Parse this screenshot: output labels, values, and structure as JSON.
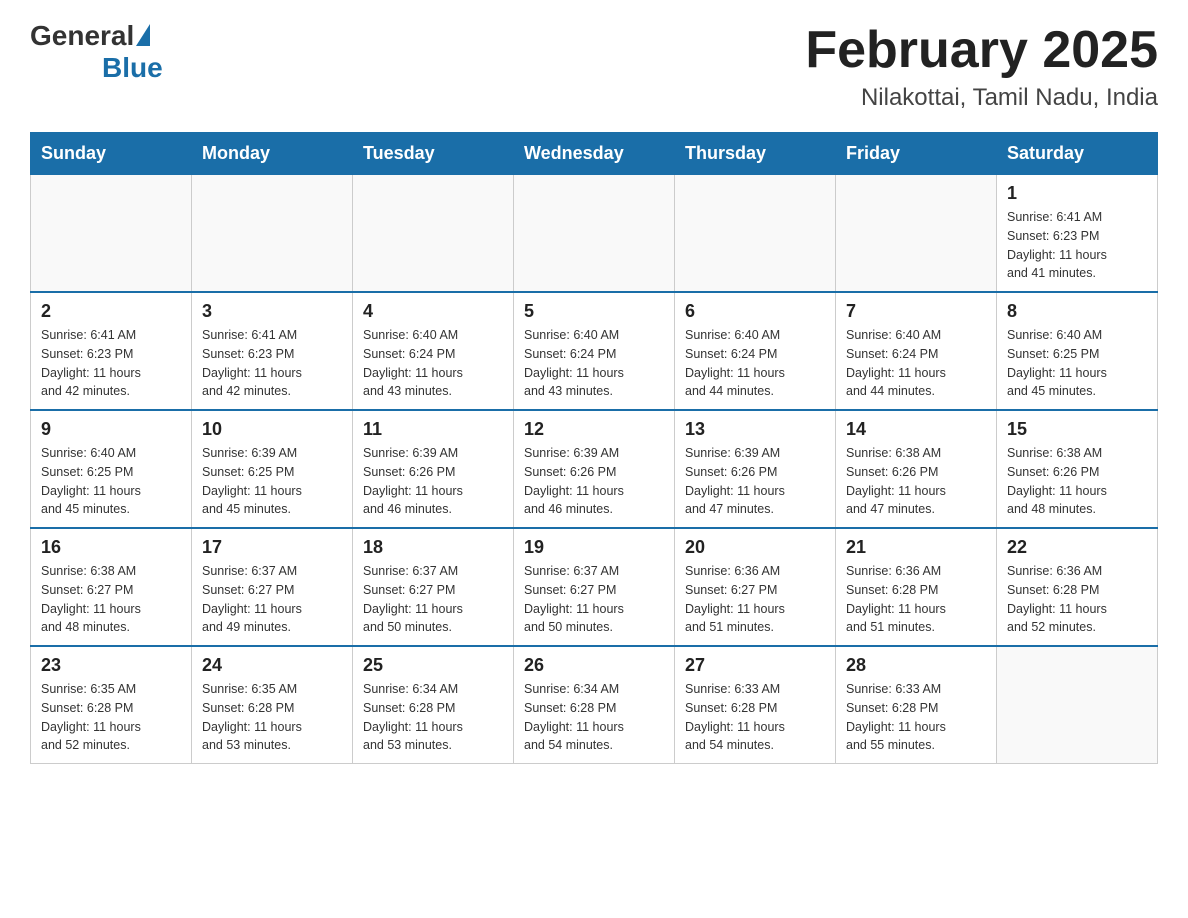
{
  "header": {
    "logo_general": "General",
    "logo_blue": "Blue",
    "month_title": "February 2025",
    "location": "Nilakottai, Tamil Nadu, India"
  },
  "weekdays": [
    "Sunday",
    "Monday",
    "Tuesday",
    "Wednesday",
    "Thursday",
    "Friday",
    "Saturday"
  ],
  "weeks": [
    [
      {
        "day": "",
        "info": ""
      },
      {
        "day": "",
        "info": ""
      },
      {
        "day": "",
        "info": ""
      },
      {
        "day": "",
        "info": ""
      },
      {
        "day": "",
        "info": ""
      },
      {
        "day": "",
        "info": ""
      },
      {
        "day": "1",
        "info": "Sunrise: 6:41 AM\nSunset: 6:23 PM\nDaylight: 11 hours\nand 41 minutes."
      }
    ],
    [
      {
        "day": "2",
        "info": "Sunrise: 6:41 AM\nSunset: 6:23 PM\nDaylight: 11 hours\nand 42 minutes."
      },
      {
        "day": "3",
        "info": "Sunrise: 6:41 AM\nSunset: 6:23 PM\nDaylight: 11 hours\nand 42 minutes."
      },
      {
        "day": "4",
        "info": "Sunrise: 6:40 AM\nSunset: 6:24 PM\nDaylight: 11 hours\nand 43 minutes."
      },
      {
        "day": "5",
        "info": "Sunrise: 6:40 AM\nSunset: 6:24 PM\nDaylight: 11 hours\nand 43 minutes."
      },
      {
        "day": "6",
        "info": "Sunrise: 6:40 AM\nSunset: 6:24 PM\nDaylight: 11 hours\nand 44 minutes."
      },
      {
        "day": "7",
        "info": "Sunrise: 6:40 AM\nSunset: 6:24 PM\nDaylight: 11 hours\nand 44 minutes."
      },
      {
        "day": "8",
        "info": "Sunrise: 6:40 AM\nSunset: 6:25 PM\nDaylight: 11 hours\nand 45 minutes."
      }
    ],
    [
      {
        "day": "9",
        "info": "Sunrise: 6:40 AM\nSunset: 6:25 PM\nDaylight: 11 hours\nand 45 minutes."
      },
      {
        "day": "10",
        "info": "Sunrise: 6:39 AM\nSunset: 6:25 PM\nDaylight: 11 hours\nand 45 minutes."
      },
      {
        "day": "11",
        "info": "Sunrise: 6:39 AM\nSunset: 6:26 PM\nDaylight: 11 hours\nand 46 minutes."
      },
      {
        "day": "12",
        "info": "Sunrise: 6:39 AM\nSunset: 6:26 PM\nDaylight: 11 hours\nand 46 minutes."
      },
      {
        "day": "13",
        "info": "Sunrise: 6:39 AM\nSunset: 6:26 PM\nDaylight: 11 hours\nand 47 minutes."
      },
      {
        "day": "14",
        "info": "Sunrise: 6:38 AM\nSunset: 6:26 PM\nDaylight: 11 hours\nand 47 minutes."
      },
      {
        "day": "15",
        "info": "Sunrise: 6:38 AM\nSunset: 6:26 PM\nDaylight: 11 hours\nand 48 minutes."
      }
    ],
    [
      {
        "day": "16",
        "info": "Sunrise: 6:38 AM\nSunset: 6:27 PM\nDaylight: 11 hours\nand 48 minutes."
      },
      {
        "day": "17",
        "info": "Sunrise: 6:37 AM\nSunset: 6:27 PM\nDaylight: 11 hours\nand 49 minutes."
      },
      {
        "day": "18",
        "info": "Sunrise: 6:37 AM\nSunset: 6:27 PM\nDaylight: 11 hours\nand 50 minutes."
      },
      {
        "day": "19",
        "info": "Sunrise: 6:37 AM\nSunset: 6:27 PM\nDaylight: 11 hours\nand 50 minutes."
      },
      {
        "day": "20",
        "info": "Sunrise: 6:36 AM\nSunset: 6:27 PM\nDaylight: 11 hours\nand 51 minutes."
      },
      {
        "day": "21",
        "info": "Sunrise: 6:36 AM\nSunset: 6:28 PM\nDaylight: 11 hours\nand 51 minutes."
      },
      {
        "day": "22",
        "info": "Sunrise: 6:36 AM\nSunset: 6:28 PM\nDaylight: 11 hours\nand 52 minutes."
      }
    ],
    [
      {
        "day": "23",
        "info": "Sunrise: 6:35 AM\nSunset: 6:28 PM\nDaylight: 11 hours\nand 52 minutes."
      },
      {
        "day": "24",
        "info": "Sunrise: 6:35 AM\nSunset: 6:28 PM\nDaylight: 11 hours\nand 53 minutes."
      },
      {
        "day": "25",
        "info": "Sunrise: 6:34 AM\nSunset: 6:28 PM\nDaylight: 11 hours\nand 53 minutes."
      },
      {
        "day": "26",
        "info": "Sunrise: 6:34 AM\nSunset: 6:28 PM\nDaylight: 11 hours\nand 54 minutes."
      },
      {
        "day": "27",
        "info": "Sunrise: 6:33 AM\nSunset: 6:28 PM\nDaylight: 11 hours\nand 54 minutes."
      },
      {
        "day": "28",
        "info": "Sunrise: 6:33 AM\nSunset: 6:28 PM\nDaylight: 11 hours\nand 55 minutes."
      },
      {
        "day": "",
        "info": ""
      }
    ]
  ]
}
